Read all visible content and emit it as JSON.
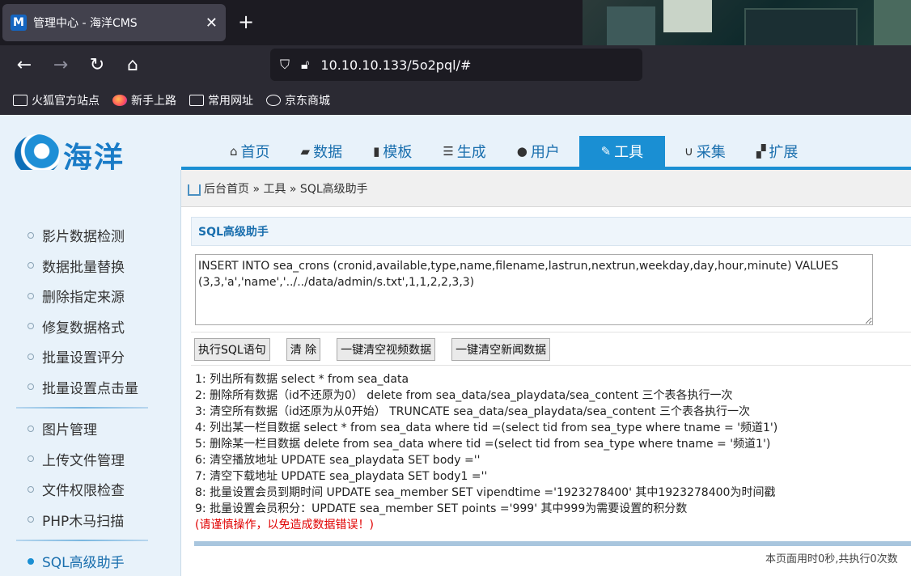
{
  "browser": {
    "tab_title": "管理中心 - 海洋CMS",
    "tab_favicon": "M",
    "url": "10.10.10.133/5o2pql/#",
    "bookmarks": [
      "火狐官方站点",
      "新手上路",
      "常用网址",
      "京东商城"
    ]
  },
  "cms": {
    "logo_text": "海洋",
    "nav": [
      {
        "label": "首页",
        "icon": "home-icon",
        "glyph": "⌂"
      },
      {
        "label": "数据",
        "icon": "book-icon",
        "glyph": "▰"
      },
      {
        "label": "模板",
        "icon": "file-icon",
        "glyph": "▮"
      },
      {
        "label": "生成",
        "icon": "server-icon",
        "glyph": "☰"
      },
      {
        "label": "用户",
        "icon": "user-icon",
        "glyph": "●"
      },
      {
        "label": "工具",
        "icon": "edit-icon",
        "glyph": "✎"
      },
      {
        "label": "采集",
        "icon": "magnet-icon",
        "glyph": "∪"
      },
      {
        "label": "扩展",
        "icon": "puzzle-icon",
        "glyph": "▞"
      }
    ],
    "active_nav": "工具",
    "breadcrumb": "后台首页 » 工具 » SQL高级助手",
    "sidebar": {
      "group1": [
        "影片数据检测",
        "数据批量替换",
        "删除指定来源",
        "修复数据格式",
        "批量设置评分",
        "批量设置点击量"
      ],
      "group2": [
        "图片管理",
        "上传文件管理",
        "文件权限检查",
        "PHP木马扫描"
      ],
      "group3": [
        "SQL高级助手"
      ]
    },
    "panel_title": "SQL高级助手",
    "sql_value": "INSERT INTO sea_crons (cronid,available,type,name,filename,lastrun,nextrun,weekday,day,hour,minute) VALUES (3,3,'a','name','../../data/admin/s.txt',1,1,2,2,3,3)",
    "buttons": {
      "execute": "执行SQL语句",
      "clear": "清 除",
      "clear_video": "一键清空视频数据",
      "clear_news": "一键清空新闻数据"
    },
    "tips": [
      "1: 列出所有数据 select * from sea_data",
      "2: 删除所有数据（id不还原为0） delete from sea_data/sea_playdata/sea_content 三个表各执行一次",
      "3: 清空所有数据（id还原为从0开始） TRUNCATE sea_data/sea_playdata/sea_content 三个表各执行一次",
      "4: 列出某一栏目数据 select * from sea_data where tid =(select tid from sea_type where tname = '频道1')",
      "5: 删除某一栏目数据 delete from sea_data where tid =(select tid from sea_type where tname = '频道1')",
      "6: 清空播放地址 UPDATE sea_playdata SET body =''",
      "7: 清空下载地址 UPDATE sea_playdata SET body1 =''",
      "8: 批量设置会员到期时间 UPDATE sea_member SET vipendtime ='1923278400' 其中1923278400为时间戳",
      "9: 批量设置会员积分：UPDATE sea_member SET points ='999' 其中999为需要设置的积分数"
    ],
    "warning": "(请谨慎操作，以免造成数据错误！)",
    "footer": "本页面用时0秒,共执行0次数"
  }
}
